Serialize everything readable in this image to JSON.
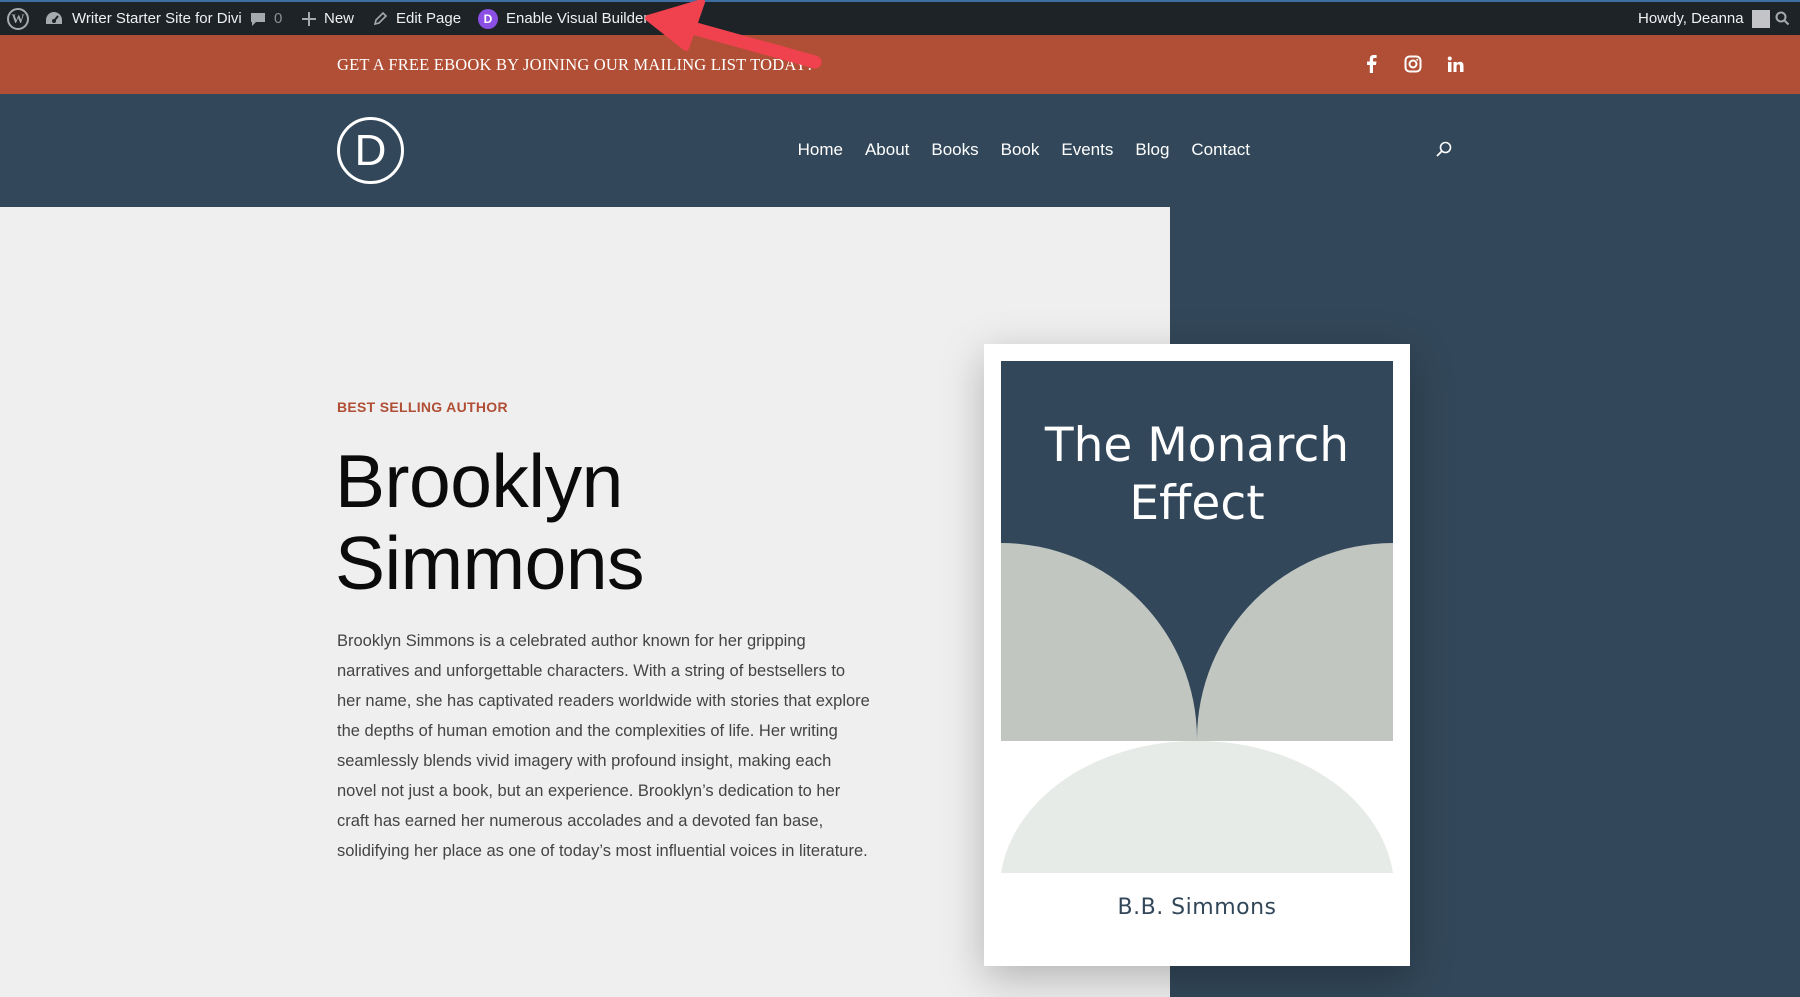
{
  "admin_bar": {
    "site_name": "Writer Starter Site for Divi",
    "comments_count": "0",
    "new_label": "New",
    "edit_label": "Edit Page",
    "visual_builder_label": "Enable Visual Builder",
    "greeting": "Howdy, Deanna"
  },
  "promo": {
    "text": "GET A FREE EBOOK BY JOINING OUR MAILING LIST TODAY!",
    "social": [
      "facebook-icon",
      "instagram-icon",
      "linkedin-icon"
    ]
  },
  "header": {
    "logo_letter": "D",
    "nav": [
      "Home",
      "About",
      "Books",
      "Book",
      "Events",
      "Blog",
      "Contact"
    ]
  },
  "hero": {
    "eyebrow": "BEST SELLING AUTHOR",
    "name_line1": "Brooklyn",
    "name_line2": "Simmons",
    "bio": "Brooklyn Simmons is a celebrated author known for her gripping narratives and unforgettable characters. With a string of bestsellers to her name, she has captivated readers worldwide with stories that explore the depths of human emotion and the complexities of life. Her writing seamlessly blends vivid imagery with profound insight, making each novel not just a book, but an experience. Brooklyn’s dedication to her craft has earned her numerous accolades and a devoted fan base, solidifying her place as one of today’s most influential voices in literature."
  },
  "book": {
    "title_line1": "The Monarch",
    "title_line2": "Effect",
    "author": "B.B. Simmons"
  },
  "colors": {
    "admin_bg": "#1d2327",
    "promo_bg": "#b04f35",
    "navy": "#324759",
    "page_bg": "#efefef",
    "accent": "#b04f35",
    "sage": "#c1c6c1",
    "mint": "#e7ebe7",
    "annotation_red": "#f0414e"
  }
}
